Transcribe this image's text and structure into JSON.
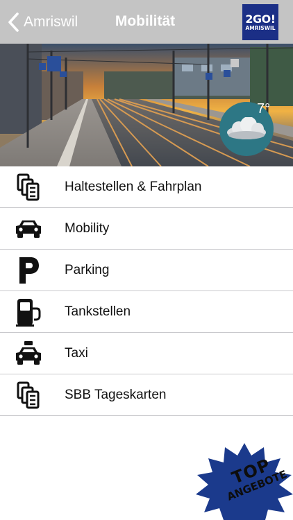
{
  "navbar": {
    "back_label": "Amriswil",
    "title": "Mobilität",
    "logo_main": "2GO!",
    "logo_sub": "AMRISWIL"
  },
  "hero": {
    "temperature": "7°",
    "weather_icon": "cloud-icon"
  },
  "menu": {
    "items": [
      {
        "label": "Haltestellen & Fahrplan",
        "icon": "ticket-stack-icon"
      },
      {
        "label": "Mobility",
        "icon": "car-icon"
      },
      {
        "label": "Parking",
        "icon": "parking-icon"
      },
      {
        "label": "Tankstellen",
        "icon": "fuel-pump-icon"
      },
      {
        "label": "Taxi",
        "icon": "taxi-icon"
      },
      {
        "label": "SBB Tageskarten",
        "icon": "ticket-stack-icon"
      }
    ]
  },
  "badge": {
    "line1": "TOP",
    "line2": "ANGEBOTE",
    "color": "#1b3a8c"
  },
  "colors": {
    "navbar": "#c4c4c4",
    "logo_bg": "#1b2f86",
    "weather_bubble": "#2d7785"
  }
}
